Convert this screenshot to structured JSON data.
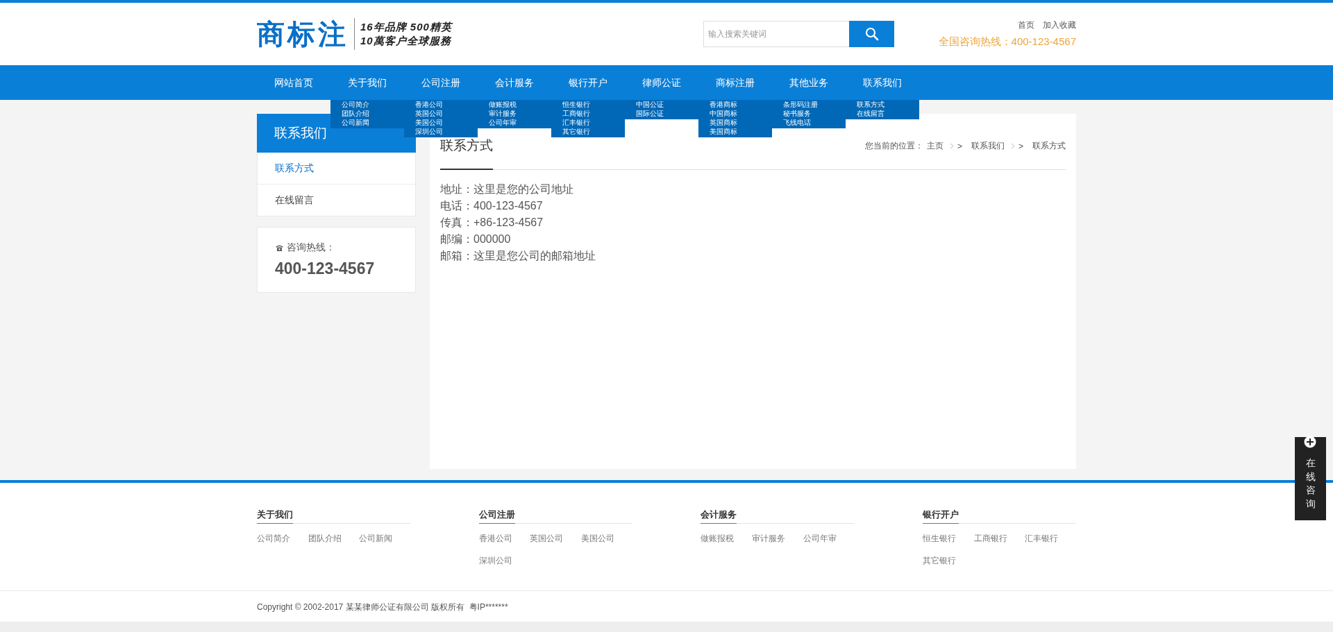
{
  "header": {
    "logo": "商标注",
    "slogan_lines": [
      "16年品牌 500精英",
      "10萬客户全球服務"
    ],
    "search": {
      "placeholder": "输入搜索关键词"
    },
    "top_links": [
      "首页",
      "加入收藏"
    ],
    "hotline": "全国咨询热线：400-123-4567"
  },
  "nav": [
    {
      "label": "网站首页"
    },
    {
      "label": "关于我们",
      "submenu": [
        "公司简介",
        "团队介绍",
        "公司新闻"
      ]
    },
    {
      "label": "公司注册",
      "submenu": [
        "香港公司",
        "英国公司",
        "美国公司",
        "深圳公司"
      ]
    },
    {
      "label": "会计服务",
      "submenu": [
        "做账报税",
        "审计服务",
        "公司年审"
      ]
    },
    {
      "label": "银行开户",
      "submenu": [
        "恒生银行",
        "工商银行",
        "汇丰银行",
        "其它银行"
      ]
    },
    {
      "label": "律师公证",
      "submenu": [
        "中国公证",
        "国际公证"
      ]
    },
    {
      "label": "商标注册",
      "submenu": [
        "香港商标",
        "中国商标",
        "英国商标",
        "美国商标"
      ]
    },
    {
      "label": "其他业务",
      "submenu": [
        "条形码注册",
        "秘书服务",
        "飞线电话"
      ]
    },
    {
      "label": "联系我们",
      "submenu": [
        "联系方式",
        "在线留言"
      ]
    }
  ],
  "sidebar": {
    "title": "联系我们",
    "items": [
      {
        "label": "联系方式",
        "selected": true
      },
      {
        "label": "在线留言",
        "selected": false
      }
    ],
    "hotline_label": "咨询热线：",
    "hotline_number": "400-123-4567"
  },
  "content": {
    "title": "联系方式",
    "breadcrumb_prefix": "您当前的位置：",
    "breadcrumb": [
      "主页",
      "联系我们",
      "联系方式"
    ],
    "breadcrumb_separator": ">",
    "lines": [
      "地址：这里是您的公司地址",
      "电话：400-123-4567",
      "传真：+86-123-4567",
      "邮编：000000",
      "邮箱：这里是您公司的邮箱地址"
    ]
  },
  "footer": {
    "columns": [
      {
        "title": "关于我们",
        "links": [
          "公司简介",
          "团队介绍",
          "公司新闻"
        ]
      },
      {
        "title": "公司注册",
        "links": [
          "香港公司",
          "英国公司",
          "美国公司",
          "深圳公司"
        ]
      },
      {
        "title": "会计服务",
        "links": [
          "做账报税",
          "审计服务",
          "公司年审"
        ]
      },
      {
        "title": "银行开户",
        "links": [
          "恒生银行",
          "工商银行",
          "汇丰银行",
          "其它银行"
        ]
      }
    ],
    "copyright": "Copyright © 2002-2017 某某律师公证有限公司 版权所有  粤IP*******"
  },
  "float_widget": {
    "label": "在线咨询"
  }
}
